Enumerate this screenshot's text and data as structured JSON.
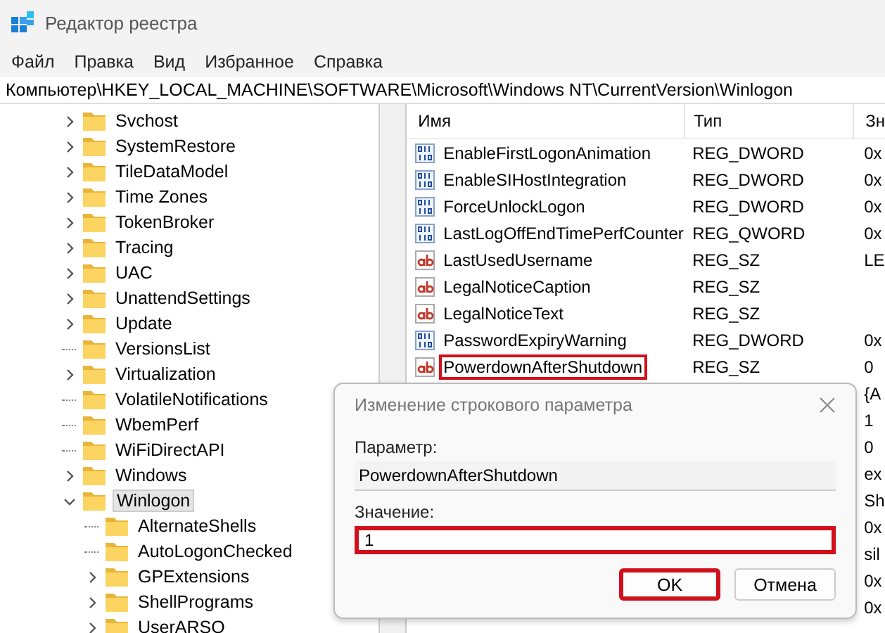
{
  "window": {
    "title": "Редактор реестра"
  },
  "menu": [
    "Файл",
    "Правка",
    "Вид",
    "Избранное",
    "Справка"
  ],
  "address": "Компьютер\\HKEY_LOCAL_MACHINE\\SOFTWARE\\Microsoft\\Windows NT\\CurrentVersion\\Winlogon",
  "tree": [
    {
      "label": "Svchost",
      "expandable": true,
      "expanded": false,
      "selected": false
    },
    {
      "label": "SystemRestore",
      "expandable": true,
      "expanded": false,
      "selected": false
    },
    {
      "label": "TileDataModel",
      "expandable": true,
      "expanded": false,
      "selected": false
    },
    {
      "label": "Time Zones",
      "expandable": true,
      "expanded": false,
      "selected": false
    },
    {
      "label": "TokenBroker",
      "expandable": true,
      "expanded": false,
      "selected": false
    },
    {
      "label": "Tracing",
      "expandable": true,
      "expanded": false,
      "selected": false
    },
    {
      "label": "UAC",
      "expandable": true,
      "expanded": false,
      "selected": false
    },
    {
      "label": "UnattendSettings",
      "expandable": true,
      "expanded": false,
      "selected": false
    },
    {
      "label": "Update",
      "expandable": true,
      "expanded": false,
      "selected": false
    },
    {
      "label": "VersionsList",
      "expandable": false,
      "selected": false
    },
    {
      "label": "Virtualization",
      "expandable": true,
      "expanded": false,
      "selected": false
    },
    {
      "label": "VolatileNotifications",
      "expandable": false,
      "selected": false
    },
    {
      "label": "WbemPerf",
      "expandable": false,
      "selected": false
    },
    {
      "label": "WiFiDirectAPI",
      "expandable": false,
      "selected": false
    },
    {
      "label": "Windows",
      "expandable": true,
      "expanded": false,
      "selected": false
    },
    {
      "label": "Winlogon",
      "expandable": true,
      "expanded": true,
      "selected": true,
      "children": [
        {
          "label": "AlternateShells",
          "expandable": false,
          "selected": false
        },
        {
          "label": "AutoLogonChecked",
          "expandable": false,
          "selected": false
        },
        {
          "label": "GPExtensions",
          "expandable": true,
          "expanded": false,
          "selected": false
        },
        {
          "label": "ShellPrograms",
          "expandable": true,
          "expanded": false,
          "selected": false
        },
        {
          "label": "UserARSO",
          "expandable": true,
          "expanded": false,
          "selected": false
        }
      ]
    }
  ],
  "table": {
    "columns": [
      "Имя",
      "Тип",
      "Зн"
    ],
    "rows": [
      {
        "kind": "binary",
        "name": "EnableFirstLogonAnimation",
        "type": "REG_DWORD",
        "value": "0x",
        "highlighted": false
      },
      {
        "kind": "binary",
        "name": "EnableSIHostIntegration",
        "type": "REG_DWORD",
        "value": "0x",
        "highlighted": false
      },
      {
        "kind": "binary",
        "name": "ForceUnlockLogon",
        "type": "REG_DWORD",
        "value": "0x",
        "highlighted": false
      },
      {
        "kind": "binary",
        "name": "LastLogOffEndTimePerfCounter",
        "type": "REG_QWORD",
        "value": "0x",
        "highlighted": false
      },
      {
        "kind": "string",
        "name": "LastUsedUsername",
        "type": "REG_SZ",
        "value": "LE",
        "highlighted": false
      },
      {
        "kind": "string",
        "name": "LegalNoticeCaption",
        "type": "REG_SZ",
        "highlighted": false
      },
      {
        "kind": "string",
        "name": "LegalNoticeText",
        "type": "REG_SZ",
        "highlighted": false
      },
      {
        "kind": "binary",
        "name": "PasswordExpiryWarning",
        "type": "REG_DWORD",
        "value": "0x",
        "highlighted": false
      },
      {
        "kind": "string",
        "name": "PowerdownAfterShutdown",
        "type": "REG_SZ",
        "value": "0",
        "highlighted": true
      },
      {
        "kind": "hidden",
        "value": "{A"
      },
      {
        "kind": "hidden",
        "value": "1"
      },
      {
        "kind": "hidden",
        "value": "0"
      },
      {
        "kind": "hidden",
        "value": "ex"
      },
      {
        "kind": "hidden",
        "value": "Sh"
      },
      {
        "kind": "hidden",
        "value": "0x"
      },
      {
        "kind": "hidden",
        "value": "sil"
      },
      {
        "kind": "hidden",
        "value": "0x"
      },
      {
        "kind": "hidden",
        "value": "0x"
      }
    ]
  },
  "dialog": {
    "title": "Изменение строкового параметра",
    "name_label": "Параметр:",
    "name_value": "PowerdownAfterShutdown",
    "value_label": "Значение:",
    "value": "1",
    "value_highlighted": true,
    "buttons": [
      {
        "label": "OK",
        "highlighted": true
      },
      {
        "label": "Отмена",
        "highlighted": false
      }
    ]
  }
}
